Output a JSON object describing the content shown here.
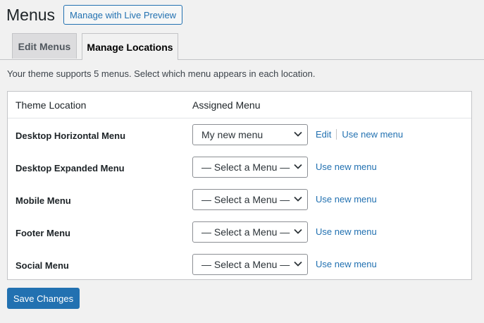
{
  "header": {
    "title": "Menus",
    "live_preview_label": "Manage with Live Preview"
  },
  "tabs": [
    {
      "label": "Edit Menus",
      "active": false
    },
    {
      "label": "Manage Locations",
      "active": true
    }
  ],
  "intro_text": "Your theme supports 5 menus. Select which menu appears in each location.",
  "table": {
    "headers": {
      "location": "Theme Location",
      "menu": "Assigned Menu"
    },
    "rows": [
      {
        "location": "Desktop Horizontal Menu",
        "selected": "My new menu",
        "edit_label": "Edit",
        "use_new_label": "Use new menu"
      },
      {
        "location": "Desktop Expanded Menu",
        "selected": "— Select a Menu —",
        "use_new_label": "Use new menu"
      },
      {
        "location": "Mobile Menu",
        "selected": "— Select a Menu —",
        "use_new_label": "Use new menu"
      },
      {
        "location": "Footer Menu",
        "selected": "— Select a Menu —",
        "use_new_label": "Use new menu"
      },
      {
        "location": "Social Menu",
        "selected": "— Select a Menu —",
        "use_new_label": "Use new menu"
      }
    ]
  },
  "save_label": "Save Changes",
  "colors": {
    "accent": "#2271b1",
    "background": "#f1f1f1"
  }
}
